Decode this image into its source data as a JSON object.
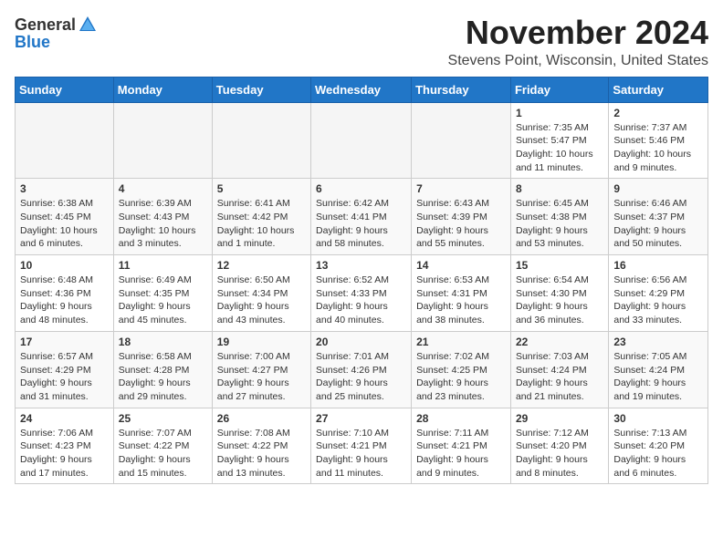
{
  "header": {
    "logo_general": "General",
    "logo_blue": "Blue",
    "month_title": "November 2024",
    "location": "Stevens Point, Wisconsin, United States"
  },
  "weekdays": [
    "Sunday",
    "Monday",
    "Tuesday",
    "Wednesday",
    "Thursday",
    "Friday",
    "Saturday"
  ],
  "weeks": [
    [
      {
        "day": "",
        "info": ""
      },
      {
        "day": "",
        "info": ""
      },
      {
        "day": "",
        "info": ""
      },
      {
        "day": "",
        "info": ""
      },
      {
        "day": "",
        "info": ""
      },
      {
        "day": "1",
        "info": "Sunrise: 7:35 AM\nSunset: 5:47 PM\nDaylight: 10 hours\nand 11 minutes."
      },
      {
        "day": "2",
        "info": "Sunrise: 7:37 AM\nSunset: 5:46 PM\nDaylight: 10 hours\nand 9 minutes."
      }
    ],
    [
      {
        "day": "3",
        "info": "Sunrise: 6:38 AM\nSunset: 4:45 PM\nDaylight: 10 hours\nand 6 minutes."
      },
      {
        "day": "4",
        "info": "Sunrise: 6:39 AM\nSunset: 4:43 PM\nDaylight: 10 hours\nand 3 minutes."
      },
      {
        "day": "5",
        "info": "Sunrise: 6:41 AM\nSunset: 4:42 PM\nDaylight: 10 hours\nand 1 minute."
      },
      {
        "day": "6",
        "info": "Sunrise: 6:42 AM\nSunset: 4:41 PM\nDaylight: 9 hours\nand 58 minutes."
      },
      {
        "day": "7",
        "info": "Sunrise: 6:43 AM\nSunset: 4:39 PM\nDaylight: 9 hours\nand 55 minutes."
      },
      {
        "day": "8",
        "info": "Sunrise: 6:45 AM\nSunset: 4:38 PM\nDaylight: 9 hours\nand 53 minutes."
      },
      {
        "day": "9",
        "info": "Sunrise: 6:46 AM\nSunset: 4:37 PM\nDaylight: 9 hours\nand 50 minutes."
      }
    ],
    [
      {
        "day": "10",
        "info": "Sunrise: 6:48 AM\nSunset: 4:36 PM\nDaylight: 9 hours\nand 48 minutes."
      },
      {
        "day": "11",
        "info": "Sunrise: 6:49 AM\nSunset: 4:35 PM\nDaylight: 9 hours\nand 45 minutes."
      },
      {
        "day": "12",
        "info": "Sunrise: 6:50 AM\nSunset: 4:34 PM\nDaylight: 9 hours\nand 43 minutes."
      },
      {
        "day": "13",
        "info": "Sunrise: 6:52 AM\nSunset: 4:33 PM\nDaylight: 9 hours\nand 40 minutes."
      },
      {
        "day": "14",
        "info": "Sunrise: 6:53 AM\nSunset: 4:31 PM\nDaylight: 9 hours\nand 38 minutes."
      },
      {
        "day": "15",
        "info": "Sunrise: 6:54 AM\nSunset: 4:30 PM\nDaylight: 9 hours\nand 36 minutes."
      },
      {
        "day": "16",
        "info": "Sunrise: 6:56 AM\nSunset: 4:29 PM\nDaylight: 9 hours\nand 33 minutes."
      }
    ],
    [
      {
        "day": "17",
        "info": "Sunrise: 6:57 AM\nSunset: 4:29 PM\nDaylight: 9 hours\nand 31 minutes."
      },
      {
        "day": "18",
        "info": "Sunrise: 6:58 AM\nSunset: 4:28 PM\nDaylight: 9 hours\nand 29 minutes."
      },
      {
        "day": "19",
        "info": "Sunrise: 7:00 AM\nSunset: 4:27 PM\nDaylight: 9 hours\nand 27 minutes."
      },
      {
        "day": "20",
        "info": "Sunrise: 7:01 AM\nSunset: 4:26 PM\nDaylight: 9 hours\nand 25 minutes."
      },
      {
        "day": "21",
        "info": "Sunrise: 7:02 AM\nSunset: 4:25 PM\nDaylight: 9 hours\nand 23 minutes."
      },
      {
        "day": "22",
        "info": "Sunrise: 7:03 AM\nSunset: 4:24 PM\nDaylight: 9 hours\nand 21 minutes."
      },
      {
        "day": "23",
        "info": "Sunrise: 7:05 AM\nSunset: 4:24 PM\nDaylight: 9 hours\nand 19 minutes."
      }
    ],
    [
      {
        "day": "24",
        "info": "Sunrise: 7:06 AM\nSunset: 4:23 PM\nDaylight: 9 hours\nand 17 minutes."
      },
      {
        "day": "25",
        "info": "Sunrise: 7:07 AM\nSunset: 4:22 PM\nDaylight: 9 hours\nand 15 minutes."
      },
      {
        "day": "26",
        "info": "Sunrise: 7:08 AM\nSunset: 4:22 PM\nDaylight: 9 hours\nand 13 minutes."
      },
      {
        "day": "27",
        "info": "Sunrise: 7:10 AM\nSunset: 4:21 PM\nDaylight: 9 hours\nand 11 minutes."
      },
      {
        "day": "28",
        "info": "Sunrise: 7:11 AM\nSunset: 4:21 PM\nDaylight: 9 hours\nand 9 minutes."
      },
      {
        "day": "29",
        "info": "Sunrise: 7:12 AM\nSunset: 4:20 PM\nDaylight: 9 hours\nand 8 minutes."
      },
      {
        "day": "30",
        "info": "Sunrise: 7:13 AM\nSunset: 4:20 PM\nDaylight: 9 hours\nand 6 minutes."
      }
    ]
  ]
}
